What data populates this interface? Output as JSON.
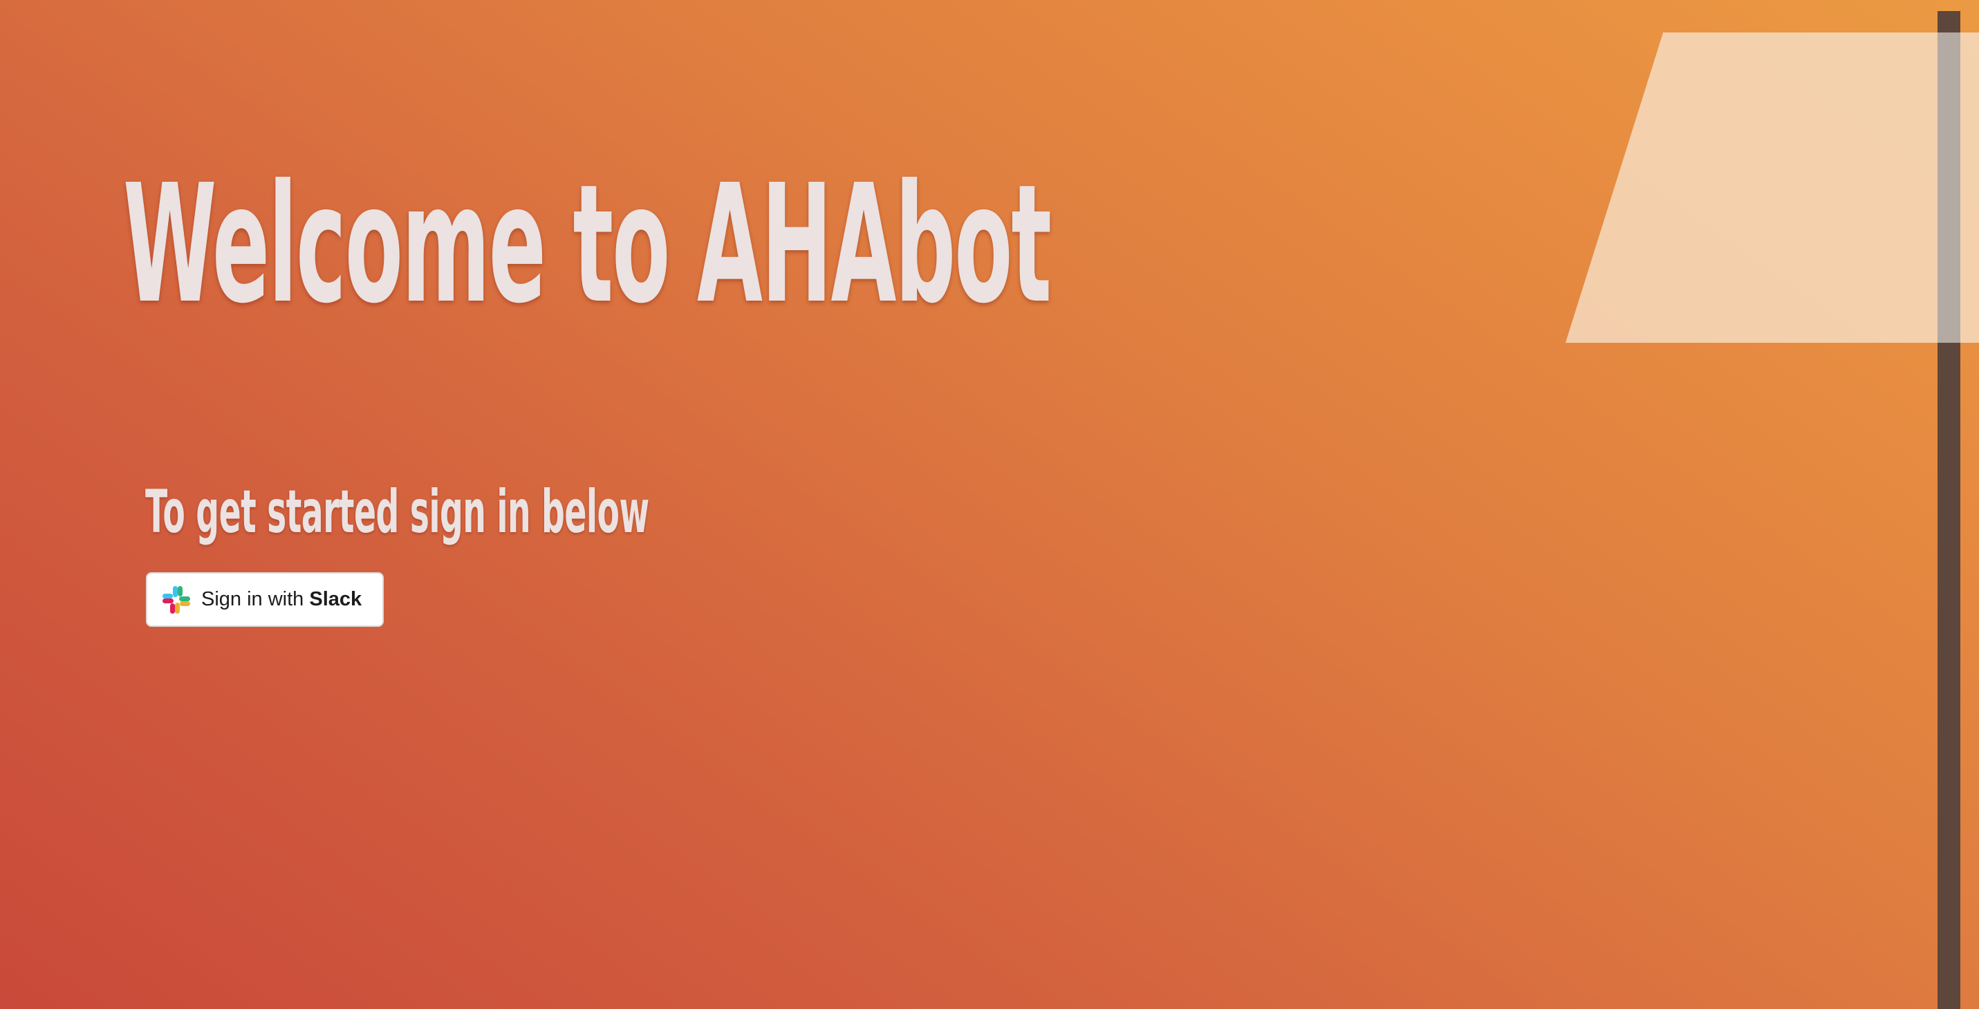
{
  "hero": {
    "title": "Welcome to AHAbot",
    "subtitle": "To get started sign in below"
  },
  "signin": {
    "prefix": "Sign in with ",
    "brand": "Slack",
    "icon": "slack-logo-icon"
  },
  "colors": {
    "background_start": "#c9493a",
    "background_end": "#eb9a43",
    "text": "#ebe2e1",
    "lamp_shade": "#f6dec4",
    "lamp_pole": "#5d463b"
  }
}
